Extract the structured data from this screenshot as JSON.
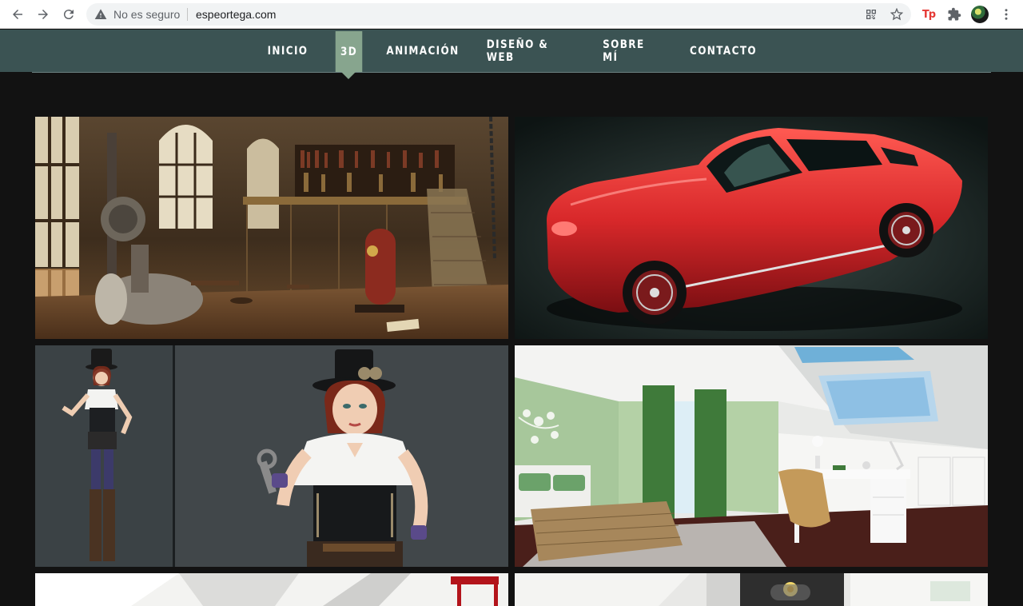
{
  "browser": {
    "security_label": "No es seguro",
    "url": "espeortega.com",
    "icons": [
      "back-arrow-icon",
      "forward-arrow-icon",
      "reload-icon",
      "warning-icon",
      "qr-code-icon",
      "bookmark-star-icon",
      "tp-extension-icon",
      "puzzle-extensions-icon",
      "profile-avatar",
      "kebab-menu-icon"
    ],
    "tp_label": "Tp"
  },
  "site": {
    "nav": {
      "items": [
        {
          "label": "INICIO"
        },
        {
          "label": "3D",
          "active": true
        },
        {
          "label": "ANIMACIÓN"
        },
        {
          "label": "DISEÑO & WEB"
        },
        {
          "label": "SOBRE MÍ"
        },
        {
          "label": "CONTACTO"
        }
      ]
    },
    "colors": {
      "header_bg": "#3b5353",
      "active_bg": "#87a58e",
      "page_bg": "#121212"
    },
    "gallery": [
      {
        "name": "steampunk-library-render"
      },
      {
        "name": "red-sports-car-render"
      },
      {
        "name": "steampunk-girl-character-render"
      },
      {
        "name": "attic-bedroom-interior-render"
      },
      {
        "name": "attic-interior-render-2"
      },
      {
        "name": "interior-render-3"
      }
    ]
  }
}
